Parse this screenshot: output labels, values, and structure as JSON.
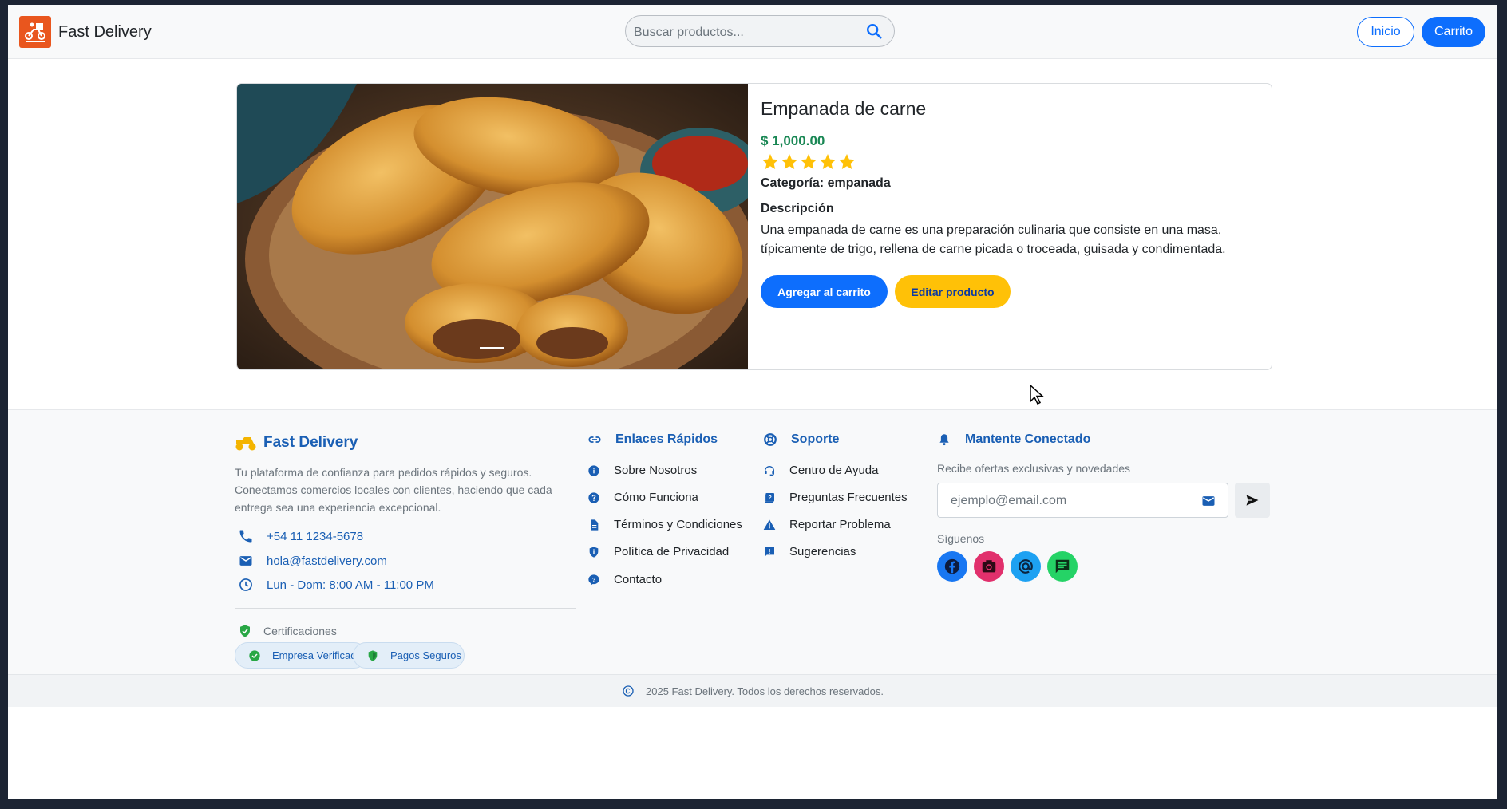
{
  "navbar": {
    "brand_name": "Fast Delivery",
    "search_placeholder": "Buscar productos...",
    "inicio_label": "Inicio",
    "carrito_label": "Carrito"
  },
  "product": {
    "title": "Empanada de carne",
    "price": "$ 1,000.00",
    "rating": 5,
    "rating_max": 5,
    "category_label": "Categoría: empanada",
    "description_heading": "Descripción",
    "description": "Una empanada de carne es una preparación culinaria que consiste en una masa, típicamente de trigo, rellena de carne picada o troceada, guisada y condimentada.",
    "add_to_cart_label": "Agregar al carrito",
    "edit_label": "Editar producto"
  },
  "footer": {
    "brand_name": "Fast Delivery",
    "tagline": "Tu plataforma de confianza para pedidos rápidos y seguros. Conectamos comercios locales con clientes, haciendo que cada entrega sea una experiencia excepcional.",
    "phone": "+54 11 1234-5678",
    "email": "hola@fastdelivery.com",
    "hours": "Lun - Dom: 8:00 AM - 11:00 PM",
    "certifications_title": "Certificaciones",
    "badges": [
      "Empresa Verificada",
      "Pagos Seguros"
    ],
    "quick_links": {
      "heading": "Enlaces Rápidos",
      "items": [
        "Sobre Nosotros",
        "Cómo Funciona",
        "Términos y Condiciones",
        "Política de Privacidad",
        "Contacto"
      ]
    },
    "support": {
      "heading": "Soporte",
      "items": [
        "Centro de Ayuda",
        "Preguntas Frecuentes",
        "Reportar Problema",
        "Sugerencias"
      ]
    },
    "newsletter": {
      "heading": "Mantente Conectado",
      "subtitle": "Recibe ofertas exclusivas y novedades",
      "placeholder": "ejemplo@email.com",
      "follow_label": "Síguenos"
    },
    "copyright": "2025 Fast Delivery. Todos los derechos reservados."
  },
  "colors": {
    "primary": "#0d6efd",
    "warning": "#ffc107",
    "price_green": "#198754",
    "footer_blue": "#1a5fb4",
    "facebook": "#1877f2",
    "instagram": "#e1306c",
    "threads": "#1da1f2",
    "whatsapp": "#25d366"
  }
}
